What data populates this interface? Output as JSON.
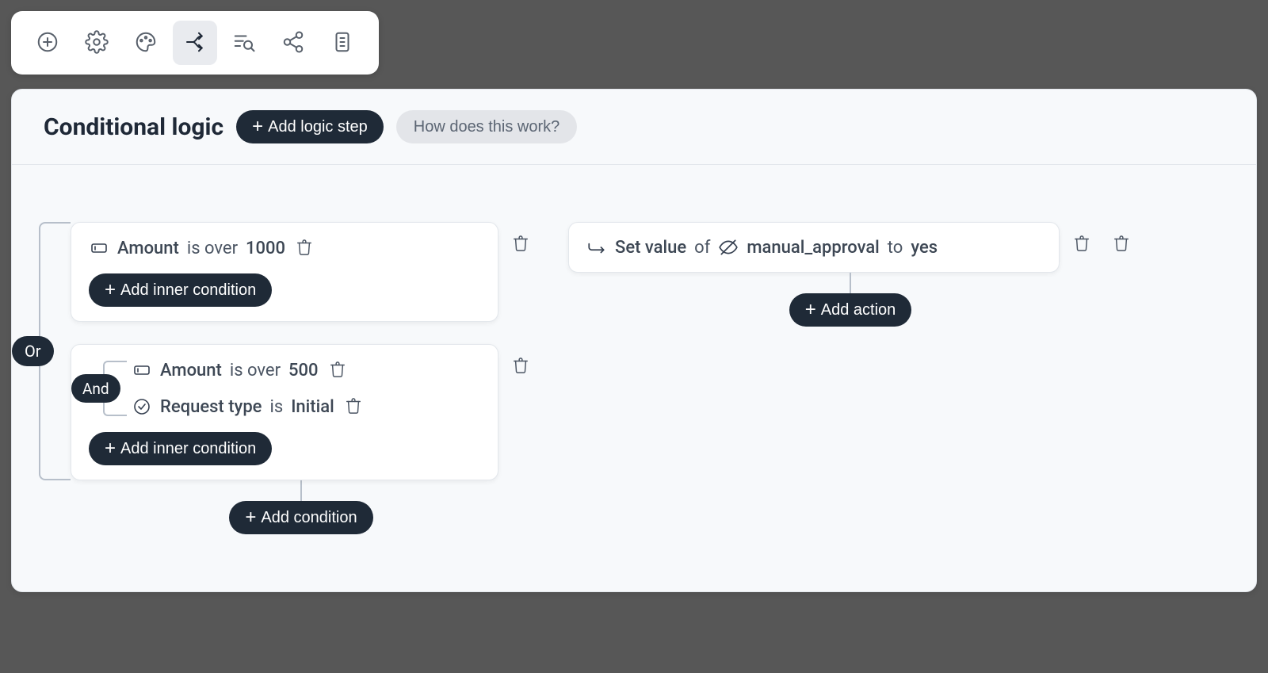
{
  "toolbar": {
    "add_icon": "plus-circle",
    "settings_icon": "gear",
    "theme_icon": "palette",
    "branch_icon": "branch",
    "filter_icon": "filter-search",
    "share_icon": "share",
    "file_icon": "file"
  },
  "panel": {
    "title": "Conditional logic",
    "add_logic_step_label": "Add logic step",
    "help_label": "How does this work?"
  },
  "logic": {
    "group_operator": "Or",
    "add_condition_label": "Add condition",
    "add_inner_condition_label": "Add inner condition",
    "conditions": [
      {
        "type": "simple",
        "rows": [
          {
            "icon": "text-input",
            "field": "Amount",
            "op": "is over",
            "value": "1000"
          }
        ]
      },
      {
        "type": "group",
        "inner_operator": "And",
        "rows": [
          {
            "icon": "text-input",
            "field": "Amount",
            "op": "is over",
            "value": "500"
          },
          {
            "icon": "check-circle",
            "field": "Request type",
            "op": "is",
            "value": "Initial"
          }
        ]
      }
    ]
  },
  "actions": {
    "add_action_label": "Add action",
    "rows": [
      {
        "prefix_icon": "action-arrow",
        "verb": "Set value",
        "of_text": "of",
        "field_icon": "eye-off",
        "field": "manual_approval",
        "to_text": "to",
        "value": "yes"
      }
    ]
  }
}
